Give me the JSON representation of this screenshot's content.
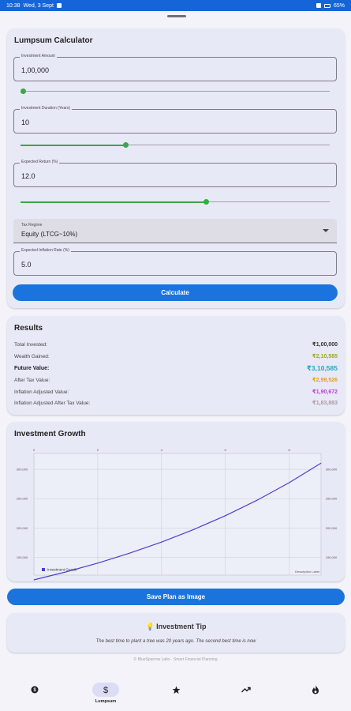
{
  "status_bar": {
    "time": "10:38",
    "date": "Wed, 3 Sept",
    "battery": "65%"
  },
  "calculator": {
    "title": "Lumpsum Calculator",
    "investment_amount": {
      "label": "Investment Amount",
      "value": "1,00,000",
      "slider_fraction": 0.01
    },
    "investment_duration": {
      "label": "Investment Duration (Years)",
      "value": "10",
      "slider_fraction": 0.34
    },
    "expected_return": {
      "label": "Expected Return (%)",
      "value": "12.0",
      "slider_fraction": 0.6
    },
    "tax_regime": {
      "label": "Tax Regime",
      "value": "Equity (LTCG~10%)"
    },
    "inflation_rate": {
      "label": "Expected Inflation Rate (%)",
      "value": "5.0"
    },
    "calculate_label": "Calculate"
  },
  "results": {
    "title": "Results",
    "rows": [
      {
        "label": "Total Invested:",
        "value": "₹1,00,000",
        "color": "#333333"
      },
      {
        "label": "Wealth Gained:",
        "value": "₹2,10,585",
        "color": "#9aa81e"
      },
      {
        "label": "Future Value:",
        "value": "₹3,10,585",
        "color": "#1fa6c8"
      },
      {
        "label": "After Tax Value:",
        "value": "₹2,99,526",
        "color": "#e89a1f"
      },
      {
        "label": "Inflation Adjusted Value:",
        "value": "₹1,90,672",
        "color": "#c23ad6"
      },
      {
        "label": "Inflation Adjusted After Tax Value:",
        "value": "₹1,83,883",
        "color": "#a89aa0"
      }
    ]
  },
  "growth": {
    "title": "Investment Growth",
    "footnote": "Description Label"
  },
  "chart_data": {
    "type": "line",
    "title": "Investment Growth",
    "x_ticks": [
      "0",
      "2",
      "4",
      "6",
      "8"
    ],
    "y_ticks": [
      "150,000",
      "200,000",
      "250,000",
      "300,000",
      "350,000"
    ],
    "xlim": [
      0,
      9
    ],
    "ylim": [
      120000,
      327000
    ],
    "series": [
      {
        "name": "Investment Growth",
        "color": "#4b3fcf",
        "x": [
          0,
          1,
          2,
          3,
          4,
          5,
          6,
          7,
          8,
          9
        ],
        "y": [
          112000,
          125440,
          140493,
          157352,
          176234,
          197382,
          221068,
          247596,
          277308,
          310585
        ]
      }
    ],
    "legend": "bottom-left",
    "grid": true
  },
  "save_plan_label": "Save Plan as Image",
  "tip": {
    "title": "💡 Investment Tip",
    "text": "The best time to plant a tree was 20 years ago. The second best time is now"
  },
  "footer": "© BlueSparrow Labs · Smart Financial Planning",
  "nav": [
    {
      "id": "sip",
      "label": "",
      "icon": "dollar-coin-icon"
    },
    {
      "id": "lumpsum",
      "label": "Lumpsum",
      "icon": "dollar-icon",
      "active": true
    },
    {
      "id": "goals",
      "label": "",
      "icon": "star-icon"
    },
    {
      "id": "trends",
      "label": "",
      "icon": "trending-up-icon"
    },
    {
      "id": "fire",
      "label": "",
      "icon": "fire-icon"
    }
  ]
}
